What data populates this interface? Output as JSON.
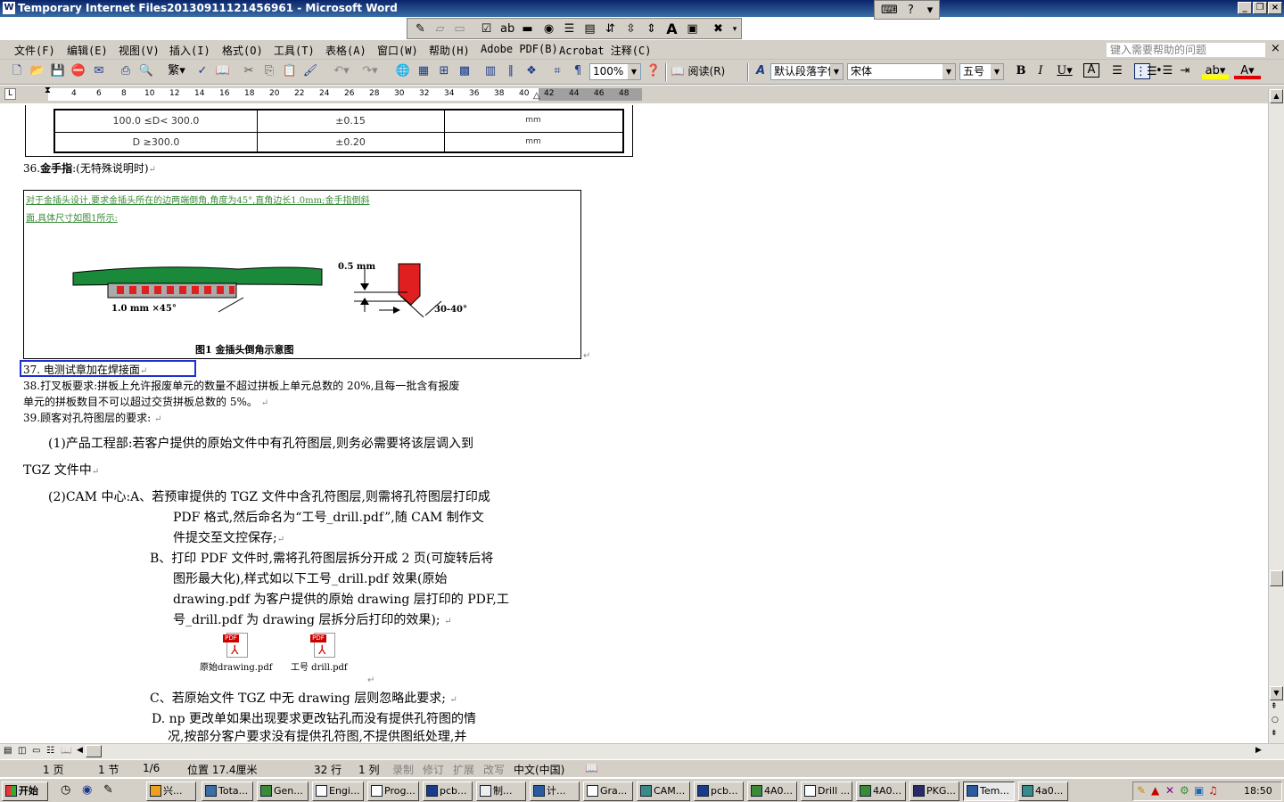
{
  "window": {
    "title": "Temporary Internet Files20130911121456961 - Microsoft Word"
  },
  "menubar": {
    "items": [
      "文件(F)",
      "编辑(E)",
      "视图(V)",
      "插入(I)",
      "格式(O)",
      "工具(T)",
      "表格(A)",
      "窗口(W)",
      "帮助(H)",
      "Adobe PDF(B)",
      "Acrobat 注释(C)"
    ],
    "help_placeholder": "键入需要帮助的问题"
  },
  "toolbar": {
    "zoom": "100%",
    "read_label": "阅读(R)",
    "style": "默认段落字体",
    "font": "宋体",
    "size": "五号"
  },
  "ruler": {
    "ticks": [
      "4",
      "6",
      "8",
      "10",
      "12",
      "14",
      "16",
      "18",
      "20",
      "22",
      "24",
      "26",
      "28",
      "30",
      "32",
      "34",
      "36",
      "38",
      "40",
      "42",
      "44",
      "46",
      "48"
    ]
  },
  "document": {
    "table_rows": [
      {
        "range": "100.0 ≤D< 300.0",
        "tol": "±0.15",
        "unit": "mm"
      },
      {
        "range": "D ≥300.0",
        "tol": "±0.20",
        "unit": "mm"
      }
    ],
    "item36_num": "36.",
    "item36_bold": "金手指",
    "item36_rest": ":(无特殊说明时)",
    "figure": {
      "text_line1": "对于金插头设计,要求金插头所在的边两端倒角,角度为45°,直角边长1.0mm;金手指倒斜",
      "text_line2": "面,具体尺寸如图1所示:",
      "dim_chamfer": "1.0 mm ×45°",
      "dim_depth": "0.5 mm",
      "dim_angle": "30-40°",
      "caption": "图1  金插头倒角示意图"
    },
    "item37": "37. 电测试章加在焊接面",
    "item38_line1": "38.打叉板要求:拼板上允许报废单元的数量不超过拼板上单元总数的 20%,且每一批含有报废",
    "item38_line2": "单元的拼板数目不可以超过交货拼板总数的 5%。",
    "item39": "39.顾客对孔符图层的要求:",
    "p1_line1": "(1)产品工程部:若客户提供的原始文件中有孔符图层,则务必需要将该层调入到",
    "p1_line2": "TGZ 文件中",
    "p2_line1": "(2)CAM 中心:A、若预审提供的 TGZ 文件中含孔符图层,则需将孔符图层打印成",
    "p2_line2": "PDF 格式,然后命名为“工号_drill.pdf”,随 CAM 制作文",
    "p2_line3": "件提交至文控保存;",
    "pb_line1": "B、打印 PDF 文件时,需将孔符图层拆分开成 2 页(可旋转后将",
    "pb_line2": "图形最大化),样式如以下工号_drill.pdf 效果(原始",
    "pb_line3": "drawing.pdf 为客户提供的原始 drawing 层打印的 PDF,工",
    "pb_line4": "号_drill.pdf 为 drawing 层拆分后打印的效果);",
    "attach1": "原始drawing.pdf",
    "attach2": "工号 drill.pdf",
    "pdf_badge": "PDF",
    "pc": "C、若原始文件 TGZ 中无 drawing 层则忽略此要求;",
    "pd_line1": "D. np 更改单如果出现要求更改钻孔而没有提供孔符图的情",
    "pd_line2": "况,按部分客户要求没有提供孔符图,不提供图纸处理,并"
  },
  "statusbar": {
    "page": "1 页",
    "section": "1 节",
    "pages": "1/6",
    "position": "位置 17.4厘米",
    "line": "32 行",
    "col": "1 列",
    "rec": "录制",
    "trk": "修订",
    "ext": "扩展",
    "ovr": "改写",
    "lang": "中文(中国)"
  },
  "taskbar": {
    "start": "开始",
    "tasks": [
      "兴...",
      "Tota...",
      "Gen...",
      "Engi...",
      "Prog...",
      "pcb...",
      "制...",
      "计...",
      "Gra...",
      "CAM...",
      "pcb...",
      "4A0...",
      "Drill ...",
      "4A0...",
      "PKG...",
      "Tem...",
      "4a0..."
    ],
    "clock": "18:50"
  },
  "colors": {
    "title_start": "#0a246a",
    "title_end": "#3a6ea5",
    "selection_box": "#1f2fd0",
    "figure_text": "#3a8a3a",
    "board_green": "#1a8a3a",
    "finger_red": "#e02020"
  }
}
